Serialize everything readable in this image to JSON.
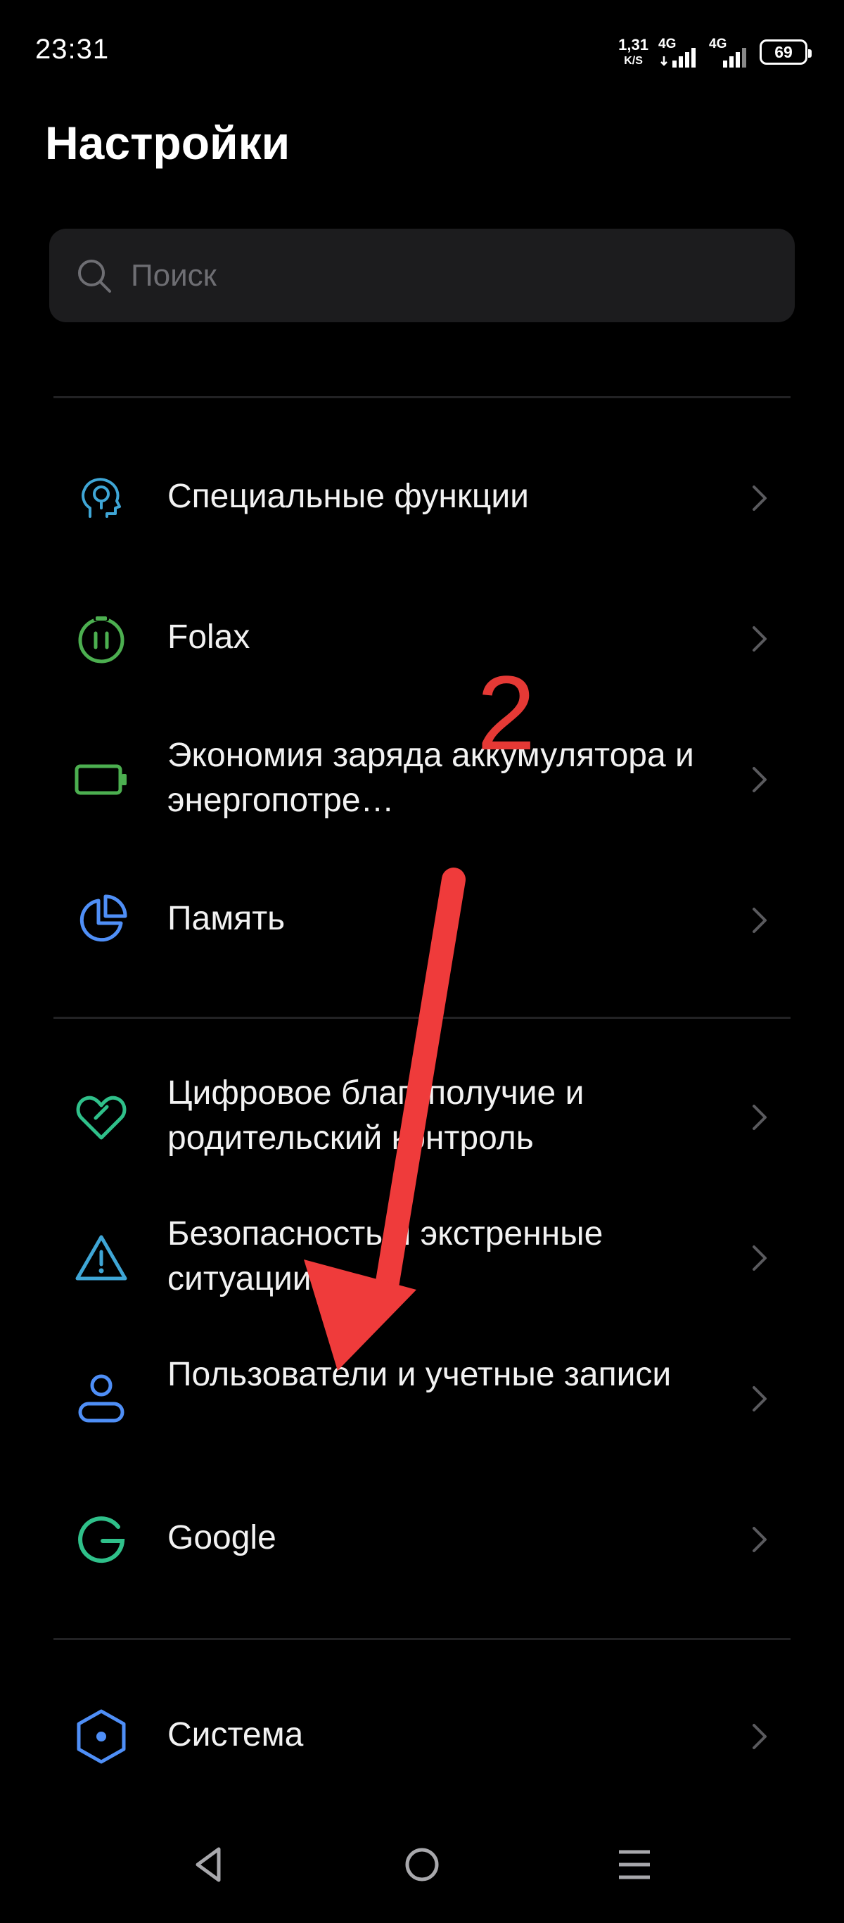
{
  "status_bar": {
    "time": "23:31",
    "net_speed_value": "1,31",
    "net_speed_unit": "K/S",
    "sim1_label": "4G",
    "sim2_label": "4G",
    "battery_level": "69"
  },
  "page": {
    "title": "Настройки"
  },
  "search": {
    "placeholder": "Поиск"
  },
  "settings_items": [
    {
      "label": "Специальные функции",
      "icon": "accessibility-head-icon",
      "icon_color": "#3fa6d6"
    },
    {
      "label": "Folax",
      "icon": "folax-icon",
      "icon_color": "#4caf50"
    },
    {
      "label": "Экономия заряда аккумулятора и энергопотре…",
      "icon": "battery-icon",
      "icon_color": "#4caf50"
    },
    {
      "label": "Память",
      "icon": "storage-pie-icon",
      "icon_color": "#4f8ff7"
    },
    {
      "label": "Цифровое благополучие и родительский контроль",
      "icon": "heart-wellbeing-icon",
      "icon_color": "#2fc08a"
    },
    {
      "label": "Безопасность и экстренные ситуации",
      "icon": "warning-icon",
      "icon_color": "#3fa6d6"
    },
    {
      "label": "Пользователи и учетные записи",
      "icon": "user-icon",
      "icon_color": "#4f8ff7"
    },
    {
      "label": "Google",
      "icon": "google-icon",
      "icon_color": "#2fc08a"
    },
    {
      "label": "Система",
      "icon": "system-hexagon-icon",
      "icon_color": "#4f8ff7"
    }
  ],
  "annotation": {
    "number": "2",
    "color": "#ef3b3b"
  },
  "navbar": {
    "back": "back-icon",
    "home": "home-icon",
    "menu": "menu-icon"
  }
}
